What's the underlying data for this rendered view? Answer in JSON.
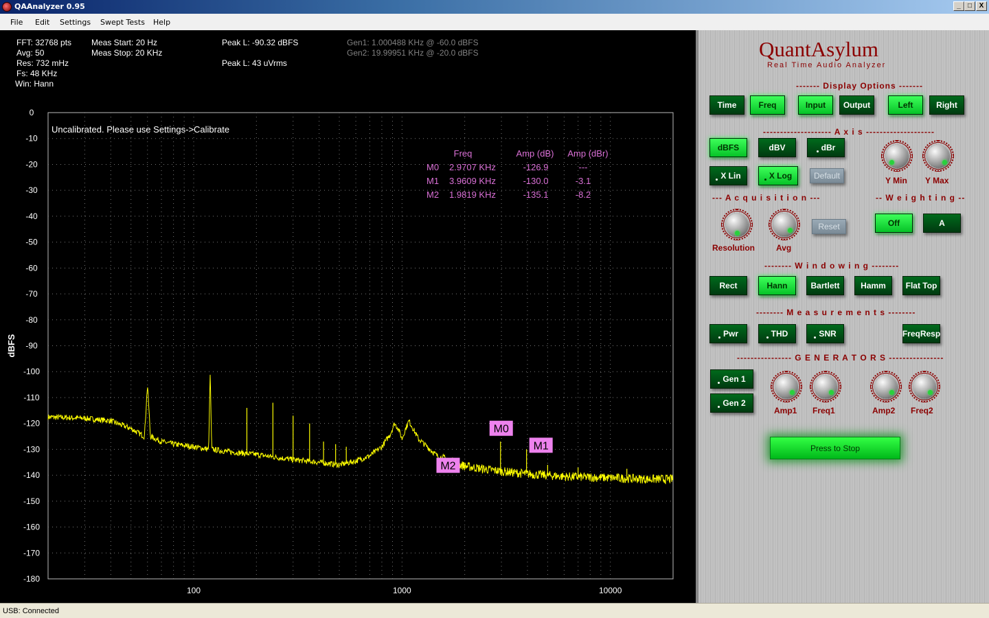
{
  "window": {
    "title": "QAAnalyzer 0.95",
    "minimize": "_",
    "maximize": "□",
    "close": "X"
  },
  "menu": [
    "File",
    "Edit",
    "Settings",
    "Swept Tests",
    "Help"
  ],
  "info": {
    "fft": "FFT: 32768 pts",
    "avg": "Avg: 50",
    "res": "Res: 732 mHz",
    "fs": "Fs: 48 KHz",
    "win": "Win: Hann",
    "meas_start": "Meas Start: 20 Hz",
    "meas_stop": "Meas Stop: 20 KHz",
    "peak_dbfs": "Peak L: -90.32 dBFS",
    "peak_urms": "Peak L: 43 uVrms",
    "gen1": "Gen1: 1.000488 KHz @ -60.0 dBFS",
    "gen2": "Gen2: 19.99951 KHz @ -20.0 dBFS"
  },
  "chart_data": {
    "type": "line",
    "ylabel": "dBFS",
    "xlabel": "",
    "xscale": "log",
    "xlim": [
      20,
      20000
    ],
    "ylim": [
      -180,
      0
    ],
    "grid": true,
    "x_ticks": [
      "100",
      "1000",
      "10000"
    ],
    "y_ticks": [
      "0",
      "-10",
      "-20",
      "-30",
      "-40",
      "-50",
      "-60",
      "-70",
      "-80",
      "-90",
      "-100",
      "-110",
      "-120",
      "-130",
      "-140",
      "-150",
      "-160",
      "-170",
      "-180"
    ],
    "annotation": "Uncalibrated. Please use Settings->Calibrate",
    "series": [
      {
        "color": "#ffff00",
        "x": [
          20,
          30,
          40,
          50,
          58,
          60,
          62,
          70,
          80,
          100,
          118,
          120,
          122,
          150,
          200,
          300,
          400,
          500,
          600,
          700,
          800,
          880,
          920,
          960,
          1000,
          1040,
          1080,
          1200,
          1500,
          2000,
          3000,
          4000,
          6000,
          10000,
          15000,
          20000
        ],
        "y": [
          -117.5,
          -118,
          -119,
          -122,
          -125,
          -105,
          -125,
          -127,
          -128,
          -129,
          -130,
          -100,
          -130,
          -131,
          -132,
          -134,
          -135,
          -136,
          -134.5,
          -132.5,
          -129,
          -124,
          -120,
          -122,
          -126,
          -122,
          -119,
          -126,
          -133,
          -136.5,
          -138.5,
          -139.5,
          -140.5,
          -141,
          -141.5,
          -141.5
        ]
      }
    ],
    "harmonics": [
      {
        "x": 180,
        "y": -114
      },
      {
        "x": 240,
        "y": -112
      },
      {
        "x": 300,
        "y": -117
      },
      {
        "x": 360,
        "y": -120
      },
      {
        "x": 420,
        "y": -127
      },
      {
        "x": 480,
        "y": -128
      },
      {
        "x": 540,
        "y": -129
      },
      {
        "x": 1980,
        "y": -135
      },
      {
        "x": 2970,
        "y": -127
      },
      {
        "x": 3960,
        "y": -130
      },
      {
        "x": 5000,
        "y": -136
      },
      {
        "x": 7000,
        "y": -137
      },
      {
        "x": 12000,
        "y": -137.5
      }
    ],
    "markers_table": {
      "headers": [
        "Freq",
        "Amp (dB)",
        "Amp (dBr)"
      ],
      "rows": [
        {
          "name": "M0",
          "freq": "2.9707 KHz",
          "amp_db": "-126.9",
          "amp_dbr": "---"
        },
        {
          "name": "M1",
          "freq": "3.9609 KHz",
          "amp_db": "-130.0",
          "amp_dbr": "-3.1"
        },
        {
          "name": "M2",
          "freq": "1.9819 KHz",
          "amp_db": "-135.1",
          "amp_dbr": "-8.2"
        }
      ]
    },
    "markers": [
      {
        "name": "M0",
        "x": 2970,
        "y": -126.9
      },
      {
        "name": "M1",
        "x": 3961,
        "y": -130.0
      },
      {
        "name": "M2",
        "x": 1982,
        "y": -135.1
      }
    ]
  },
  "panel": {
    "brand": "QuantAsylum",
    "subtitle": "Real Time Audio Analyzer",
    "sections": {
      "display": "------- Display Options -------",
      "axis": "-------------------- A x i s --------------------",
      "acq": "--- A c q u i s i t i o n ---",
      "weight": "-- W e i g h t i n g --",
      "window": "-------- W i n d o w i n g --------",
      "meas": "-------- M e a s u r e m e n t s --------",
      "gen": "---------------- G E N E R A T O R S ----------------"
    },
    "buttons": {
      "time": "Time",
      "freq": "Freq",
      "input": "Input",
      "output": "Output",
      "left": "Left",
      "right": "Right",
      "dbfs": "dBFS",
      "dbv": "dBV",
      "dbr": "dBr",
      "xlin": "X Lin",
      "xlog": "X Log",
      "default": "Default",
      "reset": "Reset",
      "off": "Off",
      "a": "A",
      "rect": "Rect",
      "hann": "Hann",
      "bartlett": "Bartlett",
      "hamm": "Hamm",
      "flattop": "Flat Top",
      "pwr": "Pwr",
      "thd": "THD",
      "snr": "SNR",
      "freqresp": "FreqResp",
      "gen1": "Gen 1",
      "gen2": "Gen 2",
      "stop": "Press to Stop"
    },
    "knobs": {
      "ymin": "Y Min",
      "ymax": "Y Max",
      "resolution": "Resolution",
      "avg": "Avg",
      "amp1": "Amp1",
      "freq1": "Freq1",
      "amp2": "Amp2",
      "freq2": "Freq2"
    }
  },
  "status": "USB: Connected"
}
